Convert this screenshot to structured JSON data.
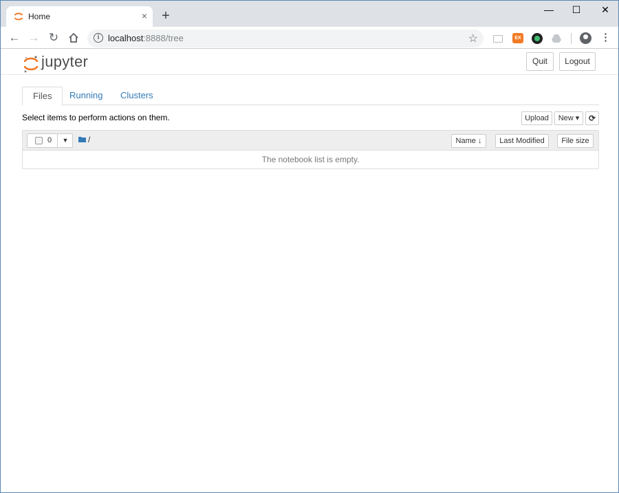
{
  "browser": {
    "tab_title": "Home",
    "tab_close": "×",
    "new_tab": "+",
    "url_host": "localhost",
    "url_rest": ":8888/tree",
    "controls": {
      "minimize": "—",
      "maximize": "☐",
      "close": "✕"
    }
  },
  "header": {
    "logo_text": "jupyter",
    "quit_label": "Quit",
    "logout_label": "Logout"
  },
  "tabs": [
    {
      "label": "Files",
      "active": true
    },
    {
      "label": "Running",
      "active": false
    },
    {
      "label": "Clusters",
      "active": false
    }
  ],
  "toolbar": {
    "hint": "Select items to perform actions on them.",
    "upload_label": "Upload",
    "new_label": "New ▾",
    "refresh_icon": "⟳"
  },
  "file_list": {
    "selected_count": "0",
    "breadcrumb": "/",
    "columns": {
      "name": "Name ↓",
      "last_modified": "Last Modified",
      "file_size": "File size"
    },
    "empty_message": "The notebook list is empty."
  },
  "colors": {
    "accent": "#f37726",
    "link": "#337ab7"
  }
}
